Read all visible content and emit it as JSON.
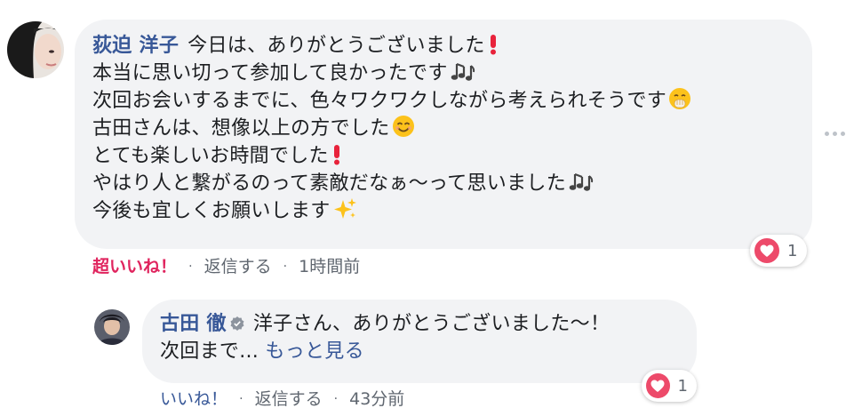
{
  "comment1": {
    "author": "荻迫 洋子",
    "lines": [
      "今日は、ありがとうございました",
      "本当に思い切って参加して良かったです",
      "次回お会いするまでに、色々ワクワクしながら考えられそうです",
      "古田さんは、想像以上の方でした",
      "とても楽しいお時間でした",
      "やはり人と繋がるのって素敵だなぁ〜って思いました",
      "今後も宜しくお願いします"
    ],
    "emojis": [
      "exclamation-icon",
      "music-notes-icon",
      "hand-over-mouth-icon",
      "smile-icon",
      "exclamation-icon",
      "music-notes-icon",
      "sparkles-icon"
    ],
    "actions": {
      "reaction_label": "超いいね！",
      "reply": "返信する",
      "time": "1時間前"
    },
    "reaction_count": "1"
  },
  "comment2": {
    "author": "古田 徹",
    "lines": [
      "洋子さん、ありがとうございました〜！",
      "次回まで..."
    ],
    "see_more": "もっと見る",
    "actions": {
      "like": "いいね！",
      "reply": "返信する",
      "time": "43分前"
    },
    "reaction_count": "1"
  },
  "colors": {
    "bubble": "#f2f3f5",
    "author": "#385898",
    "loved": "#e0245e",
    "heart": "#ed4a6a",
    "meta": "#606770"
  }
}
